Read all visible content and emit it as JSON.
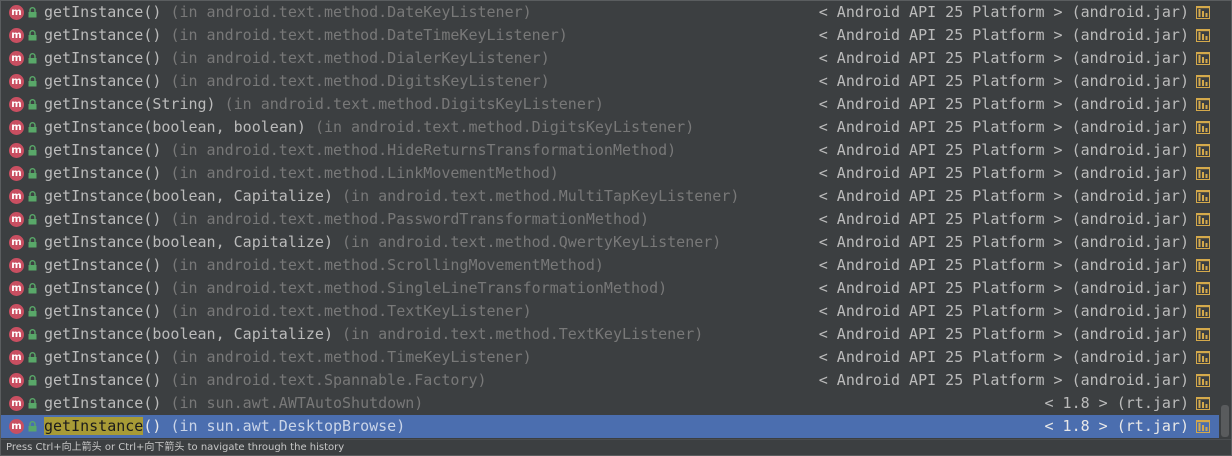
{
  "colors": {
    "background": "#3c3f41",
    "selection": "#4b6eaf",
    "match_highlight": "#a89b36",
    "method_icon": "#c94f61",
    "lock_icon": "#59a869",
    "jar_icon": "#d4a94b"
  },
  "icons": {
    "method": "method-icon",
    "visibility": "lock-icon",
    "library": "jar-icon"
  },
  "search": {
    "query": "getInstance"
  },
  "items": [
    {
      "method": "getInstance",
      "params": "()",
      "location": "(in android.text.method.DateKeyListener)",
      "library": "< Android API 25 Platform > (android.jar)"
    },
    {
      "method": "getInstance",
      "params": "()",
      "location": "(in android.text.method.DateTimeKeyListener)",
      "library": "< Android API 25 Platform > (android.jar)"
    },
    {
      "method": "getInstance",
      "params": "()",
      "location": "(in android.text.method.DialerKeyListener)",
      "library": "< Android API 25 Platform > (android.jar)"
    },
    {
      "method": "getInstance",
      "params": "()",
      "location": "(in android.text.method.DigitsKeyListener)",
      "library": "< Android API 25 Platform > (android.jar)"
    },
    {
      "method": "getInstance",
      "params": "(String)",
      "location": "(in android.text.method.DigitsKeyListener)",
      "library": "< Android API 25 Platform > (android.jar)"
    },
    {
      "method": "getInstance",
      "params": "(boolean, boolean)",
      "location": "(in android.text.method.DigitsKeyListener)",
      "library": "< Android API 25 Platform > (android.jar)"
    },
    {
      "method": "getInstance",
      "params": "()",
      "location": "(in android.text.method.HideReturnsTransformationMethod)",
      "library": "< Android API 25 Platform > (android.jar)"
    },
    {
      "method": "getInstance",
      "params": "()",
      "location": "(in android.text.method.LinkMovementMethod)",
      "library": "< Android API 25 Platform > (android.jar)"
    },
    {
      "method": "getInstance",
      "params": "(boolean, Capitalize)",
      "location": "(in android.text.method.MultiTapKeyListener)",
      "library": "< Android API 25 Platform > (android.jar)"
    },
    {
      "method": "getInstance",
      "params": "()",
      "location": "(in android.text.method.PasswordTransformationMethod)",
      "library": "< Android API 25 Platform > (android.jar)"
    },
    {
      "method": "getInstance",
      "params": "(boolean, Capitalize)",
      "location": "(in android.text.method.QwertyKeyListener)",
      "library": "< Android API 25 Platform > (android.jar)"
    },
    {
      "method": "getInstance",
      "params": "()",
      "location": "(in android.text.method.ScrollingMovementMethod)",
      "library": "< Android API 25 Platform > (android.jar)"
    },
    {
      "method": "getInstance",
      "params": "()",
      "location": "(in android.text.method.SingleLineTransformationMethod)",
      "library": "< Android API 25 Platform > (android.jar)"
    },
    {
      "method": "getInstance",
      "params": "()",
      "location": "(in android.text.method.TextKeyListener)",
      "library": "< Android API 25 Platform > (android.jar)"
    },
    {
      "method": "getInstance",
      "params": "(boolean, Capitalize)",
      "location": "(in android.text.method.TextKeyListener)",
      "library": "< Android API 25 Platform > (android.jar)"
    },
    {
      "method": "getInstance",
      "params": "()",
      "location": "(in android.text.method.TimeKeyListener)",
      "library": "< Android API 25 Platform > (android.jar)"
    },
    {
      "method": "getInstance",
      "params": "()",
      "location": "(in android.text.Spannable.Factory)",
      "library": "< Android API 25 Platform > (android.jar)"
    },
    {
      "method": "getInstance",
      "params": "()",
      "location": "(in sun.awt.AWTAutoShutdown)",
      "library": "< 1.8 > (rt.jar)"
    },
    {
      "method": "getInstance",
      "params": "()",
      "location": "(in sun.awt.DesktopBrowse)",
      "library": "< 1.8 > (rt.jar)",
      "selected": true
    }
  ],
  "status": {
    "hint": "Press Ctrl+向上箭头 or Ctrl+向下箭头 to navigate through the history"
  }
}
